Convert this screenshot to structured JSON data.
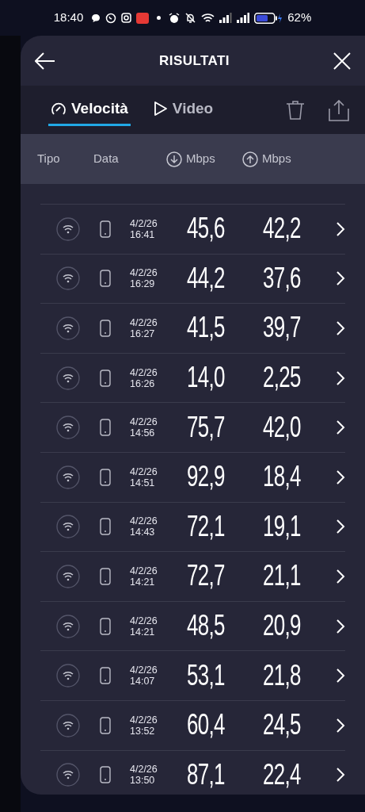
{
  "status_bar": {
    "time": "18:40",
    "battery": "62%"
  },
  "header": {
    "title": "RISULTATI"
  },
  "tabs": [
    {
      "label": "Velocità",
      "kind": "speed",
      "selected": true
    },
    {
      "label": "Video",
      "kind": "video",
      "selected": false
    }
  ],
  "table": {
    "columns": [
      "Tipo",
      "Data",
      "Mbps",
      "Mbps"
    ],
    "rows": [
      {
        "date": "4/2/26",
        "time": "16:41",
        "download": "45,6",
        "upload": "42,2"
      },
      {
        "date": "4/2/26",
        "time": "16:29",
        "download": "44,2",
        "upload": "37,6"
      },
      {
        "date": "4/2/26",
        "time": "16:27",
        "download": "41,5",
        "upload": "39,7"
      },
      {
        "date": "4/2/26",
        "time": "16:26",
        "download": "14,0",
        "upload": "2,25"
      },
      {
        "date": "4/2/26",
        "time": "14:56",
        "download": "75,7",
        "upload": "42,0"
      },
      {
        "date": "4/2/26",
        "time": "14:51",
        "download": "92,9",
        "upload": "18,4"
      },
      {
        "date": "4/2/26",
        "time": "14:43",
        "download": "72,1",
        "upload": "19,1"
      },
      {
        "date": "4/2/26",
        "time": "14:21",
        "download": "72,7",
        "upload": "21,1"
      },
      {
        "date": "4/2/26",
        "time": "14:21",
        "download": "48,5",
        "upload": "20,9"
      },
      {
        "date": "4/2/26",
        "time": "14:07",
        "download": "53,1",
        "upload": "21,8"
      },
      {
        "date": "4/2/26",
        "time": "13:52",
        "download": "60,4",
        "upload": "24,5"
      },
      {
        "date": "4/2/26",
        "time": "13:50",
        "download": "87,1",
        "upload": "22,4"
      }
    ]
  }
}
